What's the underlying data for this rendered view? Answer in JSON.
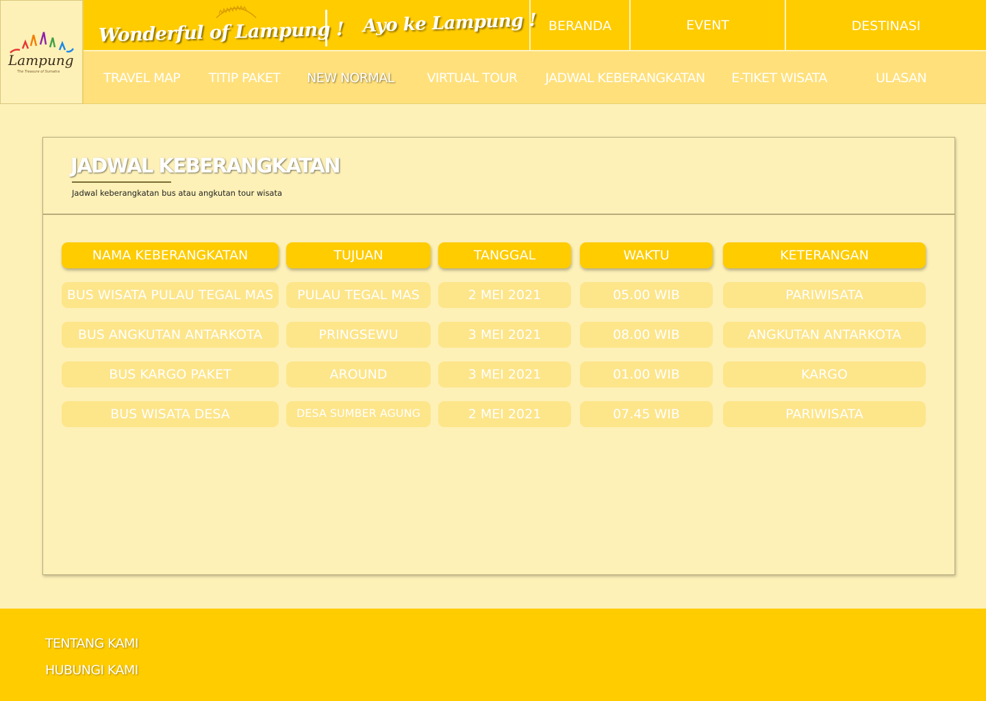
{
  "header": {
    "logo_text": "Lampung",
    "logo_tagline": "The Treasure of Sumatra",
    "slogan_1": "Wonderful of Lampung !",
    "slogan_2": "Ayo ke Lampung !",
    "top_nav": [
      "BERANDA",
      "EVENT",
      "DESTINASI"
    ],
    "sub_nav": [
      "TRAVEL MAP",
      "TITIP PAKET",
      "NEW NORMAL",
      "VIRTUAL TOUR",
      "JADWAL KEBERANGKATAN",
      "E-TIKET WISATA",
      "ULASAN"
    ]
  },
  "main": {
    "title": "JADWAL KEBERANGKATAN",
    "subtitle": "Jadwal keberangkatan bus atau angkutan tour wisata",
    "table": {
      "columns": [
        "NAMA KEBERANGKATAN",
        "TUJUAN",
        "TANGGAL",
        "WAKTU",
        "KETERANGAN"
      ],
      "rows": [
        [
          "BUS WISATA PULAU TEGAL MAS",
          "PULAU TEGAL MAS",
          "2 MEI 2021",
          "05.00 WIB",
          "PARIWISATA"
        ],
        [
          "BUS ANGKUTAN ANTARKOTA",
          "PRINGSEWU",
          "3 MEI 2021",
          "08.00 WIB",
          "ANGKUTAN ANTARKOTA"
        ],
        [
          "BUS KARGO PAKET",
          "AROUND",
          "3 MEI 2021",
          "01.00 WIB",
          "KARGO"
        ],
        [
          "BUS WISATA DESA",
          "DESA SUMBER AGUNG",
          "2 MEI 2021",
          "07.45 WIB",
          "PARIWISATA"
        ]
      ]
    }
  },
  "footer": {
    "links": [
      "TENTANG KAMI",
      "HUBUNGI KAMI"
    ]
  },
  "colors": {
    "primary": "#ffcc00",
    "secondary": "#ffe07a",
    "background": "#fdf1b8",
    "cell": "#fde58a"
  }
}
